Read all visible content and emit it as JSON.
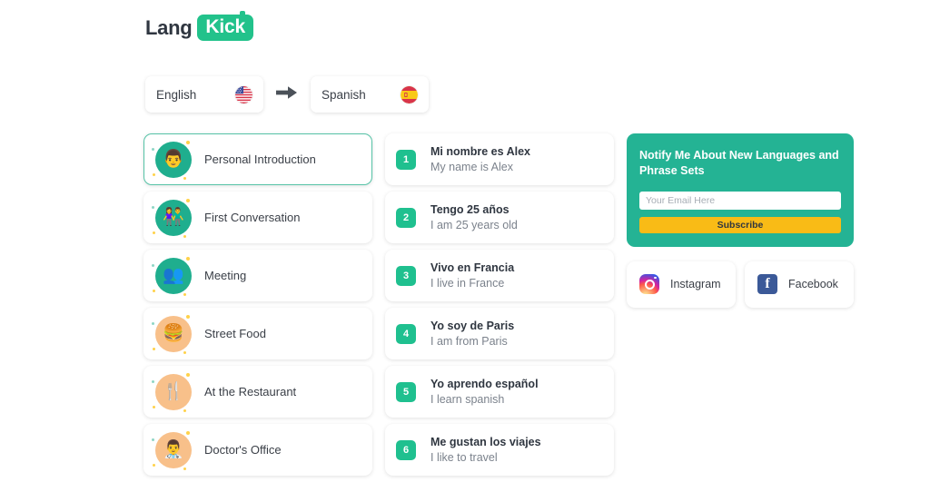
{
  "brand": {
    "name_part1": "Lang",
    "name_part2": "Kick",
    "accent_green": "#22c28b",
    "panel_green": "#24b394",
    "badge_green": "#1fc08f",
    "button_amber": "#f9bb16"
  },
  "language_selector": {
    "source": {
      "label": "English",
      "flag": "us-flag-icon"
    },
    "direction": "arrow-right-icon",
    "target": {
      "label": "Spanish",
      "flag": "spain-flag-icon"
    }
  },
  "topics": [
    {
      "label": "Personal Introduction",
      "icon": "person-avatar-icon",
      "tone": "green",
      "selected": true,
      "glyph": "👨"
    },
    {
      "label": "First Conversation",
      "icon": "two-people-icon",
      "tone": "green",
      "selected": false,
      "glyph": "👫"
    },
    {
      "label": "Meeting",
      "icon": "group-people-icon",
      "tone": "green",
      "selected": false,
      "glyph": "👥"
    },
    {
      "label": "Street Food",
      "icon": "burger-icon",
      "tone": "orange",
      "selected": false,
      "glyph": "🍔"
    },
    {
      "label": "At the Restaurant",
      "icon": "cutlery-icon",
      "tone": "orange",
      "selected": false,
      "glyph": "🍴"
    },
    {
      "label": "Doctor's Office",
      "icon": "doctor-icon",
      "tone": "orange",
      "selected": false,
      "glyph": "👨‍⚕️"
    }
  ],
  "phrases": [
    {
      "num": "1",
      "target_text": "Mi nombre es Alex",
      "source_text": "My name is Alex"
    },
    {
      "num": "2",
      "target_text": "Tengo 25 años",
      "source_text": "I am 25 years old"
    },
    {
      "num": "3",
      "target_text": "Vivo en Francia",
      "source_text": "I live in France"
    },
    {
      "num": "4",
      "target_text": "Yo soy de Paris",
      "source_text": "I am from Paris"
    },
    {
      "num": "5",
      "target_text": "Yo aprendo español",
      "source_text": "I learn spanish"
    },
    {
      "num": "6",
      "target_text": "Me gustan los viajes",
      "source_text": "I like to travel"
    }
  ],
  "subscribe": {
    "title": "Notify Me About New Languages and Phrase Sets",
    "email_placeholder": "Your Email Here",
    "email_value": "",
    "button_label": "Subscribe"
  },
  "social": [
    {
      "label": "Instagram",
      "icon": "instagram-icon"
    },
    {
      "label": "Facebook",
      "icon": "facebook-icon"
    }
  ]
}
